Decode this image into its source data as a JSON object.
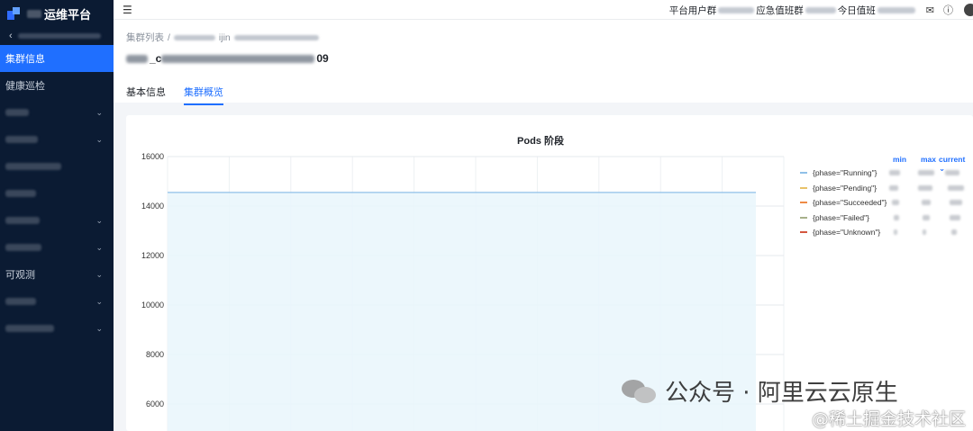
{
  "sidebar": {
    "brand_title": "运维平台",
    "items": [
      {
        "label": "集群信息",
        "active": true
      },
      {
        "label": "健康巡检"
      },
      {
        "label": "可观测"
      }
    ]
  },
  "topbar": {
    "text_platform": "平台用户群",
    "text_oncall": "应急值班群",
    "text_today": "今日值班"
  },
  "breadcrumb": {
    "root": "集群列表",
    "sep": "/",
    "current_fragment": "ijin"
  },
  "page": {
    "title_prefix": "_c",
    "title_suffix": "09"
  },
  "tabs": [
    {
      "label": "基本信息",
      "active": false
    },
    {
      "label": "集群概览",
      "active": true
    }
  ],
  "chart_data": {
    "type": "area",
    "title": "Pods 阶段",
    "xlabel": "",
    "ylabel": "",
    "ylim": [
      5000,
      16000
    ],
    "yticks": [
      6000,
      8000,
      10000,
      12000,
      14000,
      16000
    ],
    "series": [
      {
        "name": "{phase=\"Running\"}",
        "color": "#8fc0e8",
        "values": [
          14550,
          14550,
          14550,
          14550,
          14550,
          14550,
          14550,
          14550,
          14550,
          14550
        ]
      },
      {
        "name": "{phase=\"Pending\"}",
        "color": "#e8c26a",
        "values": []
      },
      {
        "name": "{phase=\"Succeeded\"}",
        "color": "#ee8a45",
        "values": []
      },
      {
        "name": "{phase=\"Failed\"}",
        "color": "#a7b08a",
        "values": []
      },
      {
        "name": "{phase=\"Unknown\"}",
        "color": "#d4563e",
        "values": []
      }
    ],
    "legend": {
      "placement": "right",
      "columns": [
        "min",
        "max",
        "current"
      ]
    }
  },
  "watermark": {
    "main": "公众号 · 阿里云云原生",
    "sub": "@稀土掘金技术社区"
  }
}
